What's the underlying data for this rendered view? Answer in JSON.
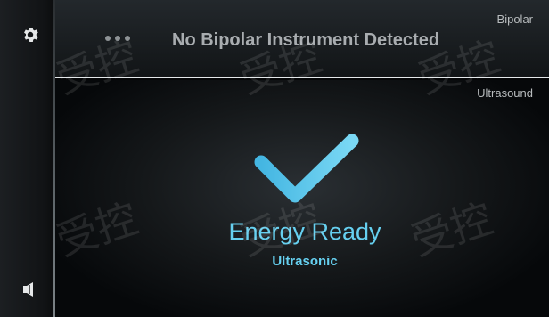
{
  "sidebar": {
    "settings_icon": "gear-icon",
    "speaker_icon": "speaker-icon"
  },
  "bipolar": {
    "channel_label": "Bipolar",
    "status": "No Bipolar Instrument Detected",
    "menu_icon": "more-dots-icon"
  },
  "ultrasound": {
    "channel_label": "Ultrasound",
    "status_icon": "checkmark-icon",
    "status": "Energy Ready",
    "mode": "Ultrasonic"
  },
  "watermark": {
    "text": "受控"
  },
  "colors": {
    "accent": "#66d0f0",
    "background": "#050607",
    "divider": "#e4e8ea"
  }
}
